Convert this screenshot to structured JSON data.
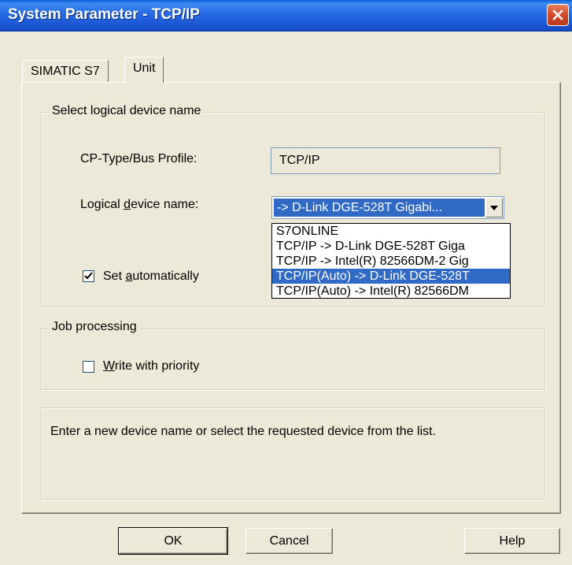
{
  "window": {
    "title": "System Parameter - TCP/IP"
  },
  "tabs": [
    {
      "label": "SIMATIC S7",
      "active": false
    },
    {
      "label": "Unit",
      "active": true
    }
  ],
  "logical_device_group": {
    "legend": "Select logical device name",
    "cp_type_label": "CP-Type/Bus Profile:",
    "cp_type_value": "TCP/IP",
    "logical_device_label_pre": "Logical ",
    "logical_device_label_accel": "d",
    "logical_device_label_post": "evice name:",
    "combo_value": "-> D-Link DGE-528T Gigabi...",
    "dropdown_items": [
      "S7ONLINE",
      "TCP/IP -> D-Link DGE-528T Giga",
      "TCP/IP -> Intel(R) 82566DM-2 Gig",
      "TCP/IP(Auto) -> D-Link DGE-528T",
      "TCP/IP(Auto) -> Intel(R) 82566DM"
    ],
    "selected_index": 3,
    "set_auto_pre": "Set ",
    "set_auto_accel": "a",
    "set_auto_post": "utomatically",
    "set_auto_checked": true
  },
  "job_group": {
    "legend": "Job processing",
    "write_accel": "W",
    "write_post": "rite with priority",
    "write_checked": false
  },
  "info": {
    "text": "Enter a new device name or select the requested device from the list."
  },
  "buttons": {
    "ok": "OK",
    "cancel": "Cancel",
    "help": "Help"
  },
  "colors": {
    "title_bar": "#2a6ee6",
    "selection": "#316ac5",
    "dialog_bg": "#ece9d8"
  }
}
